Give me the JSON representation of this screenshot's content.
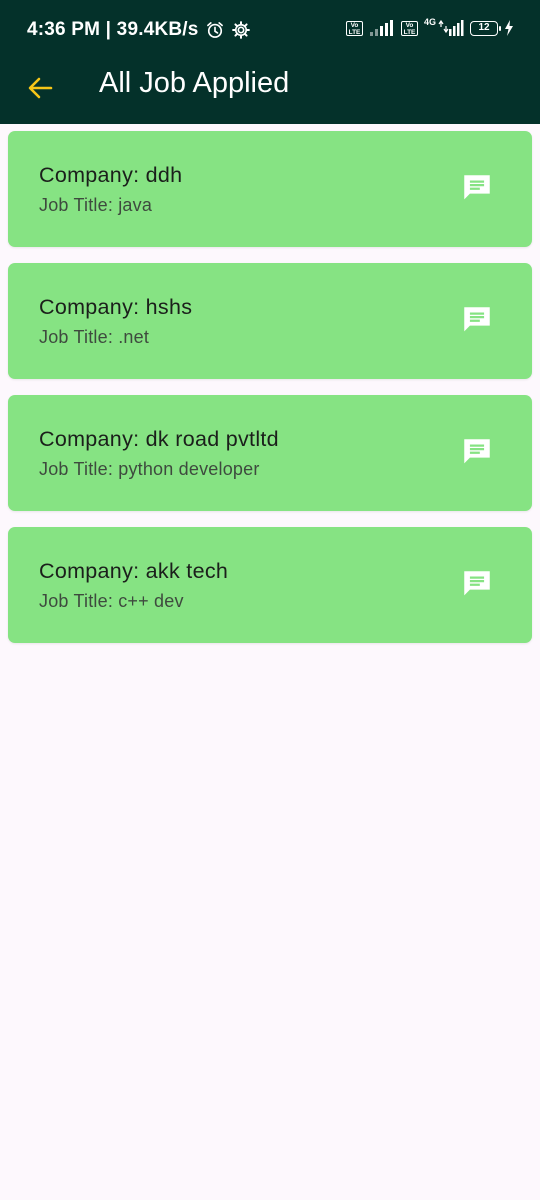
{
  "status_bar": {
    "time_speed": "4:36 PM | 39.4KB/s",
    "volte1": "Vo LTE",
    "volte2": "Vo LTE",
    "network": "4G",
    "battery": "12"
  },
  "app_bar": {
    "title": "All Job Applied",
    "accent_color": "#f5c518"
  },
  "applications": [
    {
      "company": "Company: ddh",
      "job_title": "Job Title: java"
    },
    {
      "company": "Company: hshs",
      "job_title": "Job Title: .net"
    },
    {
      "company": "Company: dk road pvtltd",
      "job_title": "Job Title: python developer"
    },
    {
      "company": "Company: akk tech",
      "job_title": "Job Title: c++ dev"
    }
  ],
  "icons": {
    "back": "arrow-back-icon",
    "message": "chat-message-icon"
  },
  "colors": {
    "header_bg": "#04312a",
    "card_bg": "#86e383",
    "page_bg": "#fdf8fd"
  }
}
